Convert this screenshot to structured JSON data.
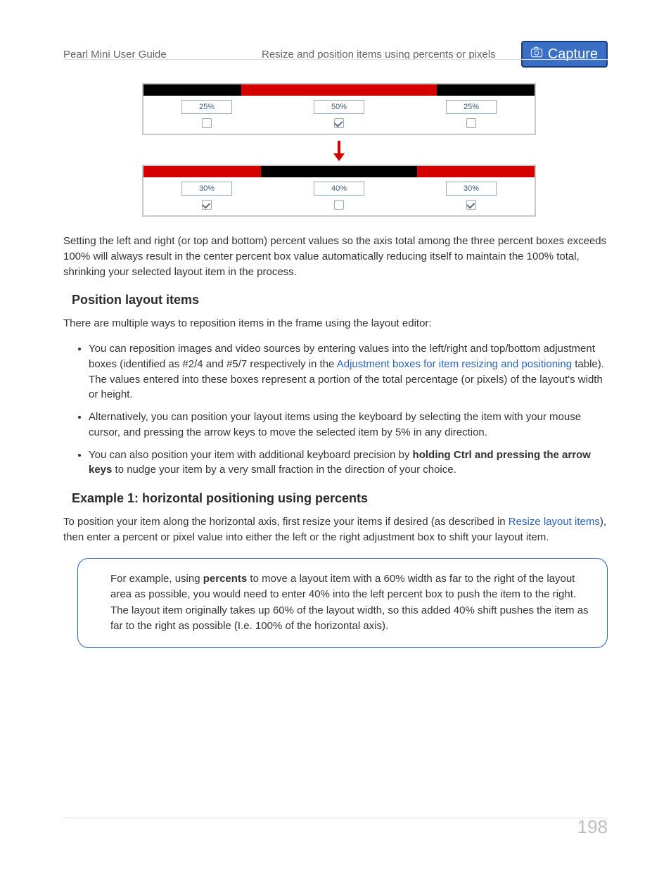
{
  "header": {
    "guide_title": "Pearl Mini User Guide",
    "section_title": "Resize and position items using percents or pixels",
    "badge_label": "Capture"
  },
  "diagram": {
    "panel_a": {
      "bar_segments": [
        {
          "color": "black",
          "width_pct": 25
        },
        {
          "color": "red",
          "width_pct": 50
        },
        {
          "color": "black",
          "width_pct": 25
        }
      ],
      "cells": [
        {
          "value": "25%",
          "checked": false
        },
        {
          "value": "50%",
          "checked": true
        },
        {
          "value": "25%",
          "checked": false
        }
      ]
    },
    "panel_b": {
      "bar_segments": [
        {
          "color": "red",
          "width_pct": 30
        },
        {
          "color": "black",
          "width_pct": 40
        },
        {
          "color": "red",
          "width_pct": 30
        }
      ],
      "cells": [
        {
          "value": "30%",
          "checked": true
        },
        {
          "value": "40%",
          "checked": false
        },
        {
          "value": "30%",
          "checked": true
        }
      ]
    }
  },
  "body": {
    "p_after_diagram": "Setting the left and right (or top and bottom) percent values so the axis total among the three percent boxes exceeds 100% will always result in the center percent box value automatically reducing itself to maintain the 100% total, shrinking your selected layout item in the process.",
    "heading_position": "Position layout items",
    "p_position_intro": "There are multiple ways to reposition items in the frame using the layout editor:",
    "bullets": {
      "b1_pre": "You can reposition images and video sources by entering values into the left/right and top/bottom adjustment boxes (identified as #2/4 and #5/7 respectively in the ",
      "b1_link": "Adjustment boxes for item resizing and positioning",
      "b1_post": " table). The values entered into these boxes represent a portion of the total percentage (or pixels) of the layout's width or height.",
      "b2": "Alternatively, you can position your layout items using the keyboard by selecting the item with your mouse cursor, and pressing the arrow keys to move the selected item by 5% in any direction.",
      "b3_pre": "You can also position your item with additional keyboard precision by ",
      "b3_bold": "holding Ctrl and pressing the arrow keys",
      "b3_post": " to nudge your item by a very small fraction in the direction of your choice."
    },
    "heading_example": "Example 1: horizontal positioning using percents",
    "p_example_pre": "To position your item along the horizontal axis, first resize your items if desired (as described in ",
    "p_example_link": "Resize layout items",
    "p_example_post": "), then enter a percent or pixel value into either the left or the right adjustment box to shift your layout item.",
    "note_pre": "For example, using ",
    "note_bold": "percents",
    "note_post": " to move a layout item with a 60% width as far to the right of the layout area as possible, you would need to enter 40% into the left percent box to push the item to the right. The layout item originally takes up 60% of the layout width, so this added 40% shift pushes the item as far to the right as possible (I.e. 100% of the horizontal axis)."
  },
  "footer": {
    "page_number": "198"
  }
}
